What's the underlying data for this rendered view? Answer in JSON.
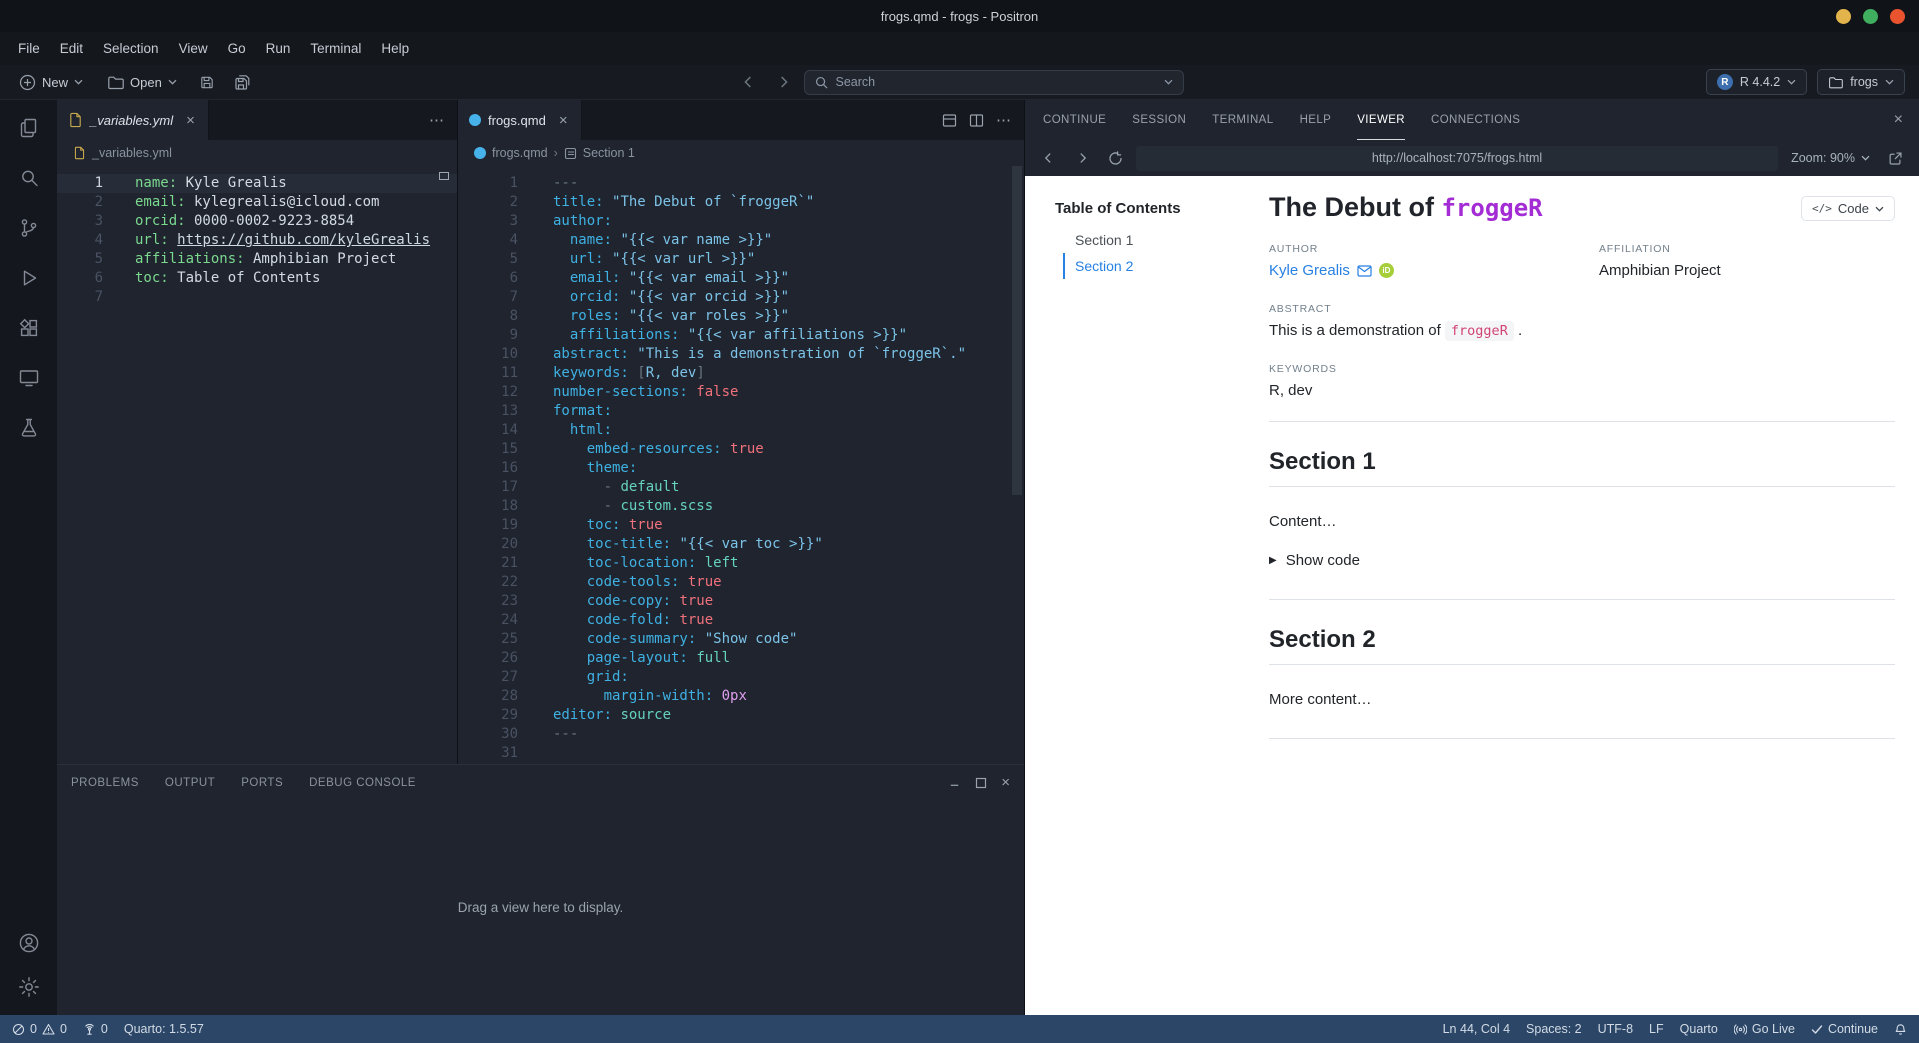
{
  "icons": [
    "explorer-icon",
    "search-icon",
    "source-control-icon",
    "run-and-debug-icon",
    "extensions-icon",
    "remote-explorer-icon",
    "testing-icon",
    "account-icon",
    "settings-gear-icon",
    "plus-icon",
    "folder-icon",
    "save-icon",
    "save-all-icon",
    "back-icon",
    "forward-icon",
    "chevron-down-icon",
    "yaml-file-icon",
    "quarto-file-icon",
    "close-icon",
    "more-actions-icon",
    "split-editor-icon",
    "editor-layout-icon",
    "reload-icon",
    "open-external-icon",
    "code-icon",
    "email-icon",
    "orcid-icon",
    "error-icon",
    "warning-icon",
    "radio-tower-icon",
    "broadcast-icon",
    "check-icon",
    "bell-icon",
    "section-symbol-icon"
  ],
  "colors": {
    "accent_blue": "#2780e3",
    "statusbar_bg": "#2c4667",
    "title_code_purple": "#a32cd4",
    "inline_code_pink": "#d24377",
    "orcid_green": "#a6ce39",
    "quarto_blue": "#47b1ea",
    "yaml_key_green": "#7bd88f",
    "qmd_key_cyan": "#3fb1e3",
    "boolean_red": "#f0717c",
    "window_min_yellow": "#e3b44b",
    "window_max_green": "#3fae5f",
    "window_close_orange": "#e9542f"
  },
  "titlebar": {
    "title": "frogs.qmd - frogs - Positron"
  },
  "menubar": {
    "items": [
      "File",
      "Edit",
      "Selection",
      "View",
      "Go",
      "Run",
      "Terminal",
      "Help"
    ]
  },
  "toolbar": {
    "new": "New",
    "open": "Open",
    "search_placeholder": "Search",
    "r_version": "R 4.4.2",
    "project": "frogs"
  },
  "left_editor": {
    "tab": "_variables.yml",
    "breadcrumb": "_variables.yml",
    "lines": [
      {
        "current": true,
        "tokens": [
          [
            "lkey",
            "name:"
          ],
          [
            "lval",
            " Kyle Grealis"
          ]
        ]
      },
      {
        "tokens": [
          [
            "lkey",
            "email:"
          ],
          [
            "lval",
            " kylegrealis@icloud.com"
          ]
        ]
      },
      {
        "tokens": [
          [
            "lkey",
            "orcid:"
          ],
          [
            "lval",
            " 0000-0002-9223-8854"
          ]
        ]
      },
      {
        "tokens": [
          [
            "lkey",
            "url:"
          ],
          [
            "lval",
            " "
          ],
          [
            "llink",
            "https://github.com/kyleGrealis"
          ]
        ]
      },
      {
        "tokens": [
          [
            "lkey",
            "affiliations:"
          ],
          [
            "lval",
            " Amphibian Project"
          ]
        ]
      },
      {
        "tokens": [
          [
            "lkey",
            "toc:"
          ],
          [
            "lval",
            " Table of Contents"
          ]
        ]
      },
      {
        "tokens": []
      }
    ]
  },
  "right_editor": {
    "tab": "frogs.qmd",
    "breadcrumb_file": "frogs.qmd",
    "breadcrumb_section": "Section 1",
    "lines": [
      {
        "tokens": [
          [
            "punc",
            "---"
          ]
        ]
      },
      {
        "tokens": [
          [
            "key",
            "title:"
          ],
          [
            "plain",
            " "
          ],
          [
            "str",
            "\"The Debut of `froggeR`\""
          ]
        ]
      },
      {
        "tokens": [
          [
            "key",
            "author:"
          ]
        ]
      },
      {
        "tokens": [
          [
            "plain",
            "  "
          ],
          [
            "key",
            "name:"
          ],
          [
            "plain",
            " "
          ],
          [
            "str",
            "\"{{< var name >}}\""
          ]
        ]
      },
      {
        "tokens": [
          [
            "plain",
            "  "
          ],
          [
            "key",
            "url:"
          ],
          [
            "plain",
            " "
          ],
          [
            "str",
            "\"{{< var url >}}\""
          ]
        ]
      },
      {
        "tokens": [
          [
            "plain",
            "  "
          ],
          [
            "key",
            "email:"
          ],
          [
            "plain",
            " "
          ],
          [
            "str",
            "\"{{< var email >}}\""
          ]
        ]
      },
      {
        "tokens": [
          [
            "plain",
            "  "
          ],
          [
            "key",
            "orcid:"
          ],
          [
            "plain",
            " "
          ],
          [
            "str",
            "\"{{< var orcid >}}\""
          ]
        ]
      },
      {
        "tokens": [
          [
            "plain",
            "  "
          ],
          [
            "key",
            "roles:"
          ],
          [
            "plain",
            " "
          ],
          [
            "str",
            "\"{{< var roles >}}\""
          ]
        ]
      },
      {
        "tokens": [
          [
            "plain",
            "  "
          ],
          [
            "key",
            "affiliations:"
          ],
          [
            "plain",
            " "
          ],
          [
            "str",
            "\"{{< var affiliations >}}\""
          ]
        ]
      },
      {
        "tokens": [
          [
            "key",
            "abstract:"
          ],
          [
            "plain",
            " "
          ],
          [
            "str",
            "\"This is a demonstration of `froggeR`.\""
          ]
        ]
      },
      {
        "tokens": [
          [
            "key",
            "keywords:"
          ],
          [
            "plain",
            " "
          ],
          [
            "punc",
            "["
          ],
          [
            "str",
            "R, dev"
          ],
          [
            "punc",
            "]"
          ]
        ]
      },
      {
        "tokens": [
          [
            "key",
            "number-sections:"
          ],
          [
            "plain",
            " "
          ],
          [
            "bool",
            "false"
          ]
        ]
      },
      {
        "tokens": [
          [
            "key",
            "format:"
          ]
        ]
      },
      {
        "tokens": [
          [
            "plain",
            "  "
          ],
          [
            "key",
            "html:"
          ]
        ]
      },
      {
        "tokens": [
          [
            "plain",
            "    "
          ],
          [
            "key",
            "embed-resources:"
          ],
          [
            "plain",
            " "
          ],
          [
            "bool",
            "true"
          ]
        ]
      },
      {
        "tokens": [
          [
            "plain",
            "    "
          ],
          [
            "key",
            "theme:"
          ]
        ]
      },
      {
        "tokens": [
          [
            "plain",
            "      "
          ],
          [
            "punc",
            "- "
          ],
          [
            "val",
            "default"
          ]
        ]
      },
      {
        "tokens": [
          [
            "plain",
            "      "
          ],
          [
            "punc",
            "- "
          ],
          [
            "val",
            "custom.scss"
          ]
        ]
      },
      {
        "tokens": [
          [
            "plain",
            "    "
          ],
          [
            "key",
            "toc:"
          ],
          [
            "plain",
            " "
          ],
          [
            "bool",
            "true"
          ]
        ]
      },
      {
        "tokens": [
          [
            "plain",
            "    "
          ],
          [
            "key",
            "toc-title:"
          ],
          [
            "plain",
            " "
          ],
          [
            "str",
            "\"{{< var toc >}}\""
          ]
        ]
      },
      {
        "tokens": [
          [
            "plain",
            "    "
          ],
          [
            "key",
            "toc-location:"
          ],
          [
            "plain",
            " "
          ],
          [
            "val",
            "left"
          ]
        ]
      },
      {
        "tokens": [
          [
            "plain",
            "    "
          ],
          [
            "key",
            "code-tools:"
          ],
          [
            "plain",
            " "
          ],
          [
            "bool",
            "true"
          ]
        ]
      },
      {
        "tokens": [
          [
            "plain",
            "    "
          ],
          [
            "key",
            "code-copy:"
          ],
          [
            "plain",
            " "
          ],
          [
            "bool",
            "true"
          ]
        ]
      },
      {
        "tokens": [
          [
            "plain",
            "    "
          ],
          [
            "key",
            "code-fold:"
          ],
          [
            "plain",
            " "
          ],
          [
            "bool",
            "true"
          ]
        ]
      },
      {
        "tokens": [
          [
            "plain",
            "    "
          ],
          [
            "key",
            "code-summary:"
          ],
          [
            "plain",
            " "
          ],
          [
            "str",
            "\"Show code\""
          ]
        ]
      },
      {
        "tokens": [
          [
            "plain",
            "    "
          ],
          [
            "key",
            "page-layout:"
          ],
          [
            "plain",
            " "
          ],
          [
            "val",
            "full"
          ]
        ]
      },
      {
        "tokens": [
          [
            "plain",
            "    "
          ],
          [
            "key",
            "grid:"
          ]
        ]
      },
      {
        "tokens": [
          [
            "plain",
            "      "
          ],
          [
            "key",
            "margin-width:"
          ],
          [
            "plain",
            " "
          ],
          [
            "num",
            "0px"
          ]
        ]
      },
      {
        "tokens": [
          [
            "key",
            "editor:"
          ],
          [
            "plain",
            " "
          ],
          [
            "val",
            "source"
          ]
        ]
      },
      {
        "tokens": [
          [
            "punc",
            "---"
          ]
        ]
      },
      {
        "tokens": []
      }
    ]
  },
  "panel": {
    "tabs": [
      "PROBLEMS",
      "OUTPUT",
      "PORTS",
      "DEBUG CONSOLE"
    ],
    "empty_message": "Drag a view here to display."
  },
  "right_panel": {
    "tabs": [
      "CONTINUE",
      "SESSION",
      "TERMINAL",
      "HELP",
      "VIEWER",
      "CONNECTIONS"
    ],
    "active_tab": "VIEWER",
    "url": "http://localhost:7075/frogs.html",
    "zoom": "Zoom: 90%"
  },
  "viewer": {
    "toc_title": "Table of Contents",
    "toc_items": [
      {
        "label": "Section 1",
        "active": false
      },
      {
        "label": "Section 2",
        "active": true
      }
    ],
    "title_plain": "The Debut of ",
    "title_code": "froggeR",
    "code_button": "Code",
    "author_label": "AUTHOR",
    "author_name": "Kyle Grealis",
    "affiliation_label": "AFFILIATION",
    "affiliation": "Amphibian Project",
    "abstract_label": "ABSTRACT",
    "abstract_pre": "This is a demonstration of ",
    "abstract_code": "froggeR",
    "abstract_post": " .",
    "keywords_label": "KEYWORDS",
    "keywords": "R, dev",
    "sections": [
      {
        "heading": "Section 1",
        "content": "Content…",
        "show_code": "Show code"
      },
      {
        "heading": "Section 2",
        "content": "More content…"
      }
    ]
  },
  "statusbar": {
    "errors": "0",
    "warnings": "0",
    "ports": "0",
    "quarto_version": "Quarto: 1.5.57",
    "cursor": "Ln 44, Col 4",
    "indentation": "Spaces: 2",
    "encoding": "UTF-8",
    "eol": "LF",
    "language": "Quarto",
    "go_live": "Go Live",
    "continue_label": "Continue"
  }
}
